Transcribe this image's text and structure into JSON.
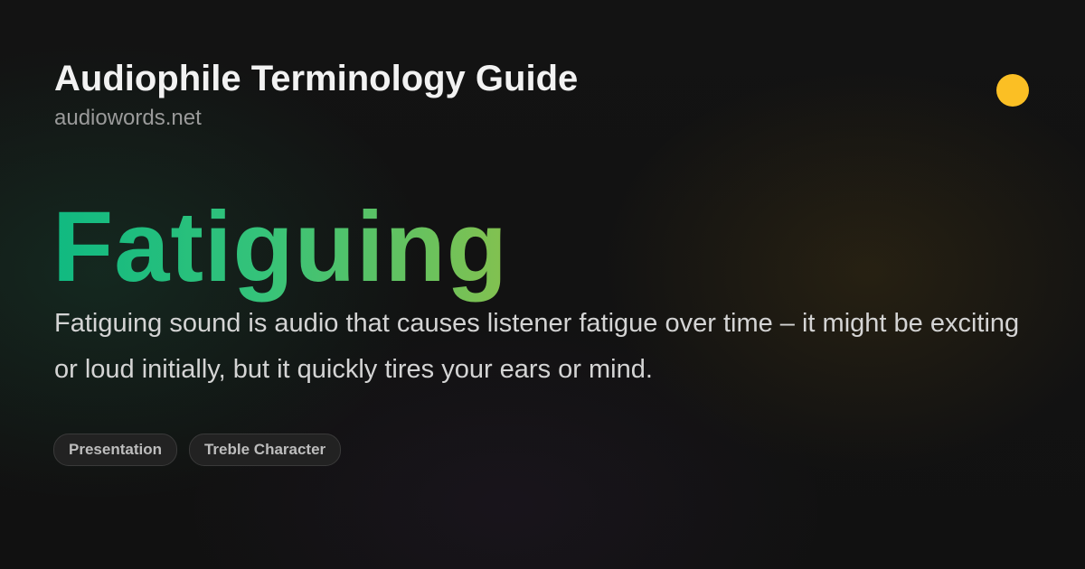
{
  "header": {
    "site_title": "Audiophile Terminology Guide",
    "site_url": "audiowords.net"
  },
  "accent_dot_color": "#fbbf24",
  "term": {
    "word": "Fatiguing",
    "gradient_colors": [
      "#10b981",
      "#84c14f"
    ],
    "definition": "Fatiguing sound is audio that causes listener fatigue over time – it might be exciting or loud initially, but it quickly tires your ears or mind."
  },
  "tags": [
    {
      "label": "Presentation"
    },
    {
      "label": "Treble Character"
    }
  ]
}
